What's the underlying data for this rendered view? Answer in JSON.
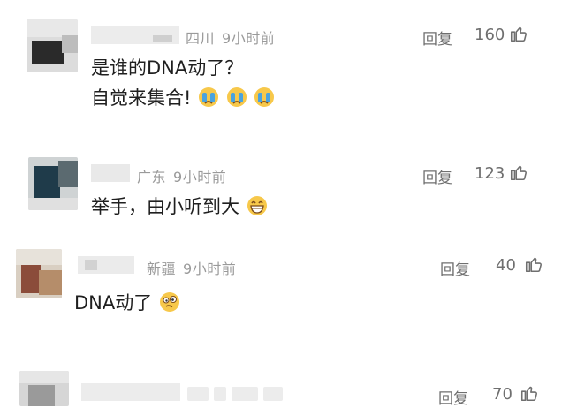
{
  "comments": [
    {
      "location": "四川",
      "time": "9小时前",
      "reply_label": "回复",
      "like_count": "160",
      "lines": [
        "是谁的DNA动了？",
        "自觉来集合!"
      ]
    },
    {
      "location": "广东",
      "time": "9小时前",
      "reply_label": "回复",
      "like_count": "123",
      "lines": [
        "举手，由小听到大"
      ]
    },
    {
      "location": "新疆",
      "time": "9小时前",
      "reply_label": "回复",
      "like_count": "40",
      "lines": [
        "DNA动了"
      ]
    },
    {
      "location": "",
      "time": "",
      "reply_label": "回复",
      "like_count": "70",
      "lines": []
    }
  ],
  "icons": {
    "like": "thumbs-up-icon",
    "emoji_crying": "crying-face-emoji-icon",
    "emoji_grin": "grinning-face-emoji-icon",
    "emoji_dizzy": "woozy-face-emoji-icon"
  },
  "colors": {
    "meta_gray": "#9a9a9a",
    "action_gray": "#6f6f6f",
    "text": "#1f1f1f",
    "emoji_yellow": "#f7c84a"
  }
}
